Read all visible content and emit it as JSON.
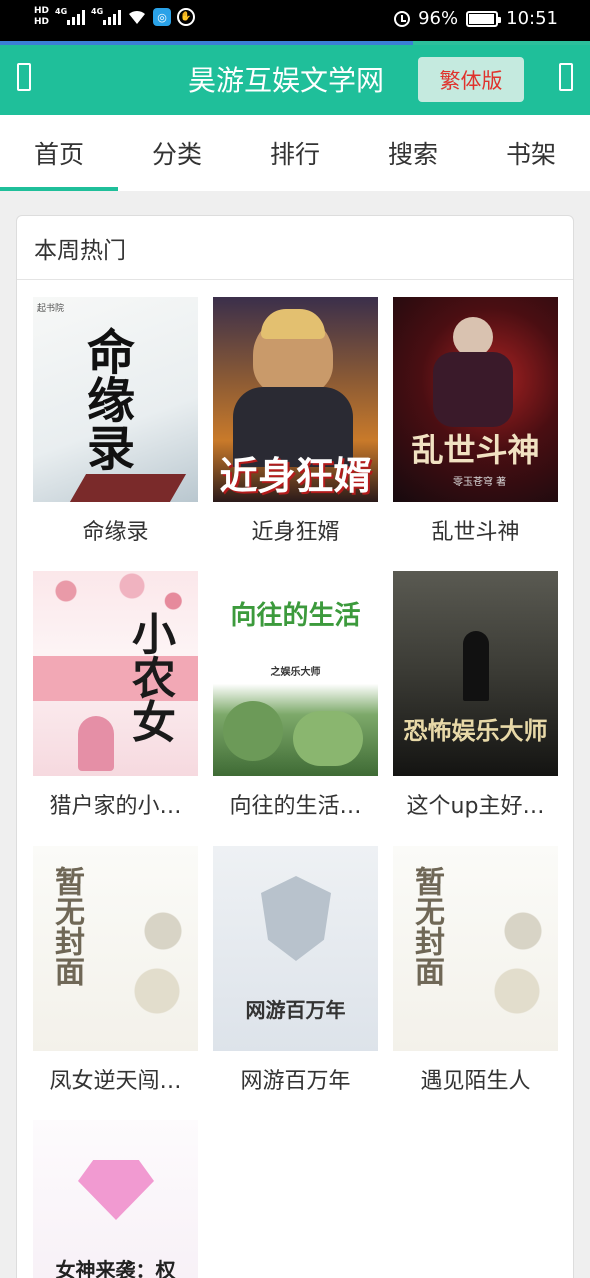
{
  "status_bar": {
    "network_left": "HD",
    "network_sub": "HD",
    "signal1_label": "4G",
    "signal2_label": "4G",
    "battery": "96%",
    "battery_level": 0.96,
    "time": "10:51"
  },
  "page_progress": 0.7,
  "header": {
    "title": "昊游互娱文学网",
    "trad_button": "繁体版"
  },
  "tabs": [
    "首页",
    "分类",
    "排行",
    "搜索",
    "书架"
  ],
  "active_tab": 0,
  "section": {
    "title": "本周热门",
    "books": [
      {
        "title": "命缘录",
        "cover_text": "命缘录",
        "cover_small": "起书院"
      },
      {
        "title": "近身狂婿",
        "cover_text": "近身狂婿",
        "cover_small": ""
      },
      {
        "title": "乱世斗神",
        "cover_text": "乱世斗神",
        "cover_small": "零玉苍穹 著"
      },
      {
        "title": "猎户家的小…",
        "cover_text": "小农女",
        "cover_small": ""
      },
      {
        "title": "向往的生活…",
        "cover_text": "向往的生活",
        "cover_small": "之娱乐大师"
      },
      {
        "title": "这个up主好…",
        "cover_text": "恐怖娱乐大师",
        "cover_small": ""
      },
      {
        "title": "凤女逆天闯…",
        "cover_text": "暂无封面",
        "cover_small": ""
      },
      {
        "title": "网游百万年",
        "cover_text": "网游百万年",
        "cover_small": ""
      },
      {
        "title": "遇见陌生人",
        "cover_text": "暂无封面",
        "cover_small": ""
      },
      {
        "title": "",
        "cover_text": "女神来袭：权",
        "cover_small": ""
      }
    ]
  },
  "colors": {
    "brand": "#1fbf9a",
    "trad_button_text": "#e0322c"
  }
}
